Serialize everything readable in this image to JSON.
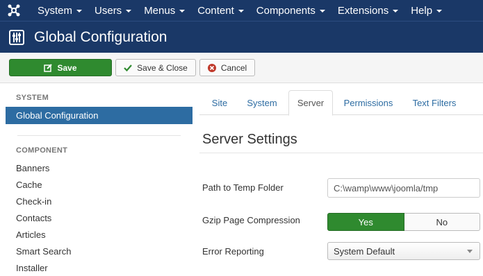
{
  "nav": {
    "items": [
      {
        "label": "System"
      },
      {
        "label": "Users"
      },
      {
        "label": "Menus"
      },
      {
        "label": "Content"
      },
      {
        "label": "Components"
      },
      {
        "label": "Extensions"
      },
      {
        "label": "Help"
      }
    ]
  },
  "header": {
    "title": "Global Configuration",
    "icon": "settings-sliders-icon"
  },
  "toolbar": {
    "save_label": "Save",
    "save_close_label": "Save & Close",
    "cancel_label": "Cancel",
    "colors": {
      "save": "#2f8a2f",
      "cancel_icon": "#c0392b"
    }
  },
  "sidebar": {
    "system_heading": "SYSTEM",
    "active_item": "Global Configuration",
    "component_heading": "COMPONENT",
    "items": [
      {
        "label": "Banners"
      },
      {
        "label": "Cache"
      },
      {
        "label": "Check-in"
      },
      {
        "label": "Contacts"
      },
      {
        "label": "Articles"
      },
      {
        "label": "Smart Search"
      },
      {
        "label": "Installer"
      }
    ]
  },
  "tabs": [
    {
      "label": "Site"
    },
    {
      "label": "System"
    },
    {
      "label": "Server",
      "active": true
    },
    {
      "label": "Permissions"
    },
    {
      "label": "Text Filters"
    }
  ],
  "main": {
    "section_title": "Server Settings",
    "temp_folder": {
      "label": "Path to Temp Folder",
      "value": "C:\\wamp\\www\\joomla/tmp"
    },
    "gzip": {
      "label": "Gzip Page Compression",
      "yes": "Yes",
      "no": "No",
      "selected": "Yes"
    },
    "error_reporting": {
      "label": "Error Reporting",
      "value": "System Default"
    }
  }
}
